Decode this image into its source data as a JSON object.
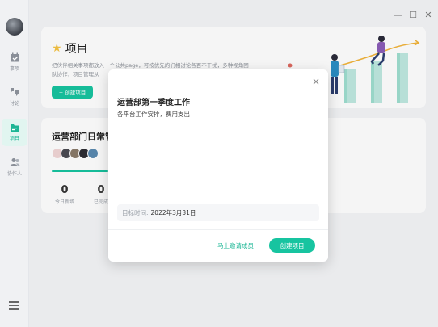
{
  "sidebar": {
    "items": [
      {
        "label": "事项",
        "icon": "calendar-check-icon",
        "active": false
      },
      {
        "label": "讨论",
        "icon": "discussion-icon",
        "active": false
      },
      {
        "label": "项目",
        "icon": "folder-icon",
        "active": true
      },
      {
        "label": "协作人",
        "icon": "people-icon",
        "active": false
      }
    ],
    "menu_icon": "hamburger-menu-icon"
  },
  "window": {
    "minimize": "—",
    "maximize": "☐",
    "close": "✕"
  },
  "header": {
    "title": "项目",
    "description": "把伙伴相关事项都放入一个公共page，可按优先的们相讨论各百不干扰，多种视角团队协作，项目管理从",
    "create_button": "+ 创建项目"
  },
  "project_card": {
    "name": "运营部门日常管",
    "stats": [
      {
        "value": "0",
        "label": "今日新增"
      },
      {
        "value": "0",
        "label": "已完成"
      }
    ]
  },
  "modal": {
    "title": "运营部第一季度工作",
    "description": "各平台工作安排，费用支出",
    "date_label": "目标时间:",
    "date_value": "2022年3月31日",
    "invite_label": "马上邀请成员",
    "create_label": "创建项目",
    "close": "×"
  },
  "colors": {
    "accent": "#17c4a0",
    "active_bg": "#e1f5f0"
  }
}
